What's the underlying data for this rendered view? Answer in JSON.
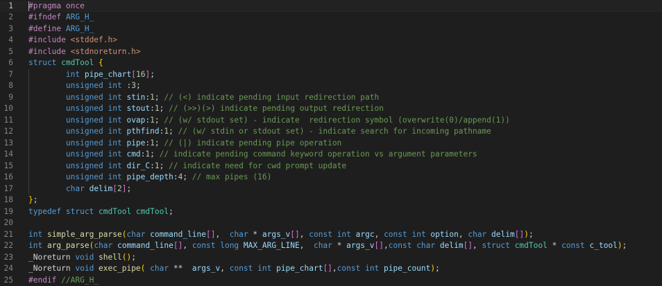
{
  "editor": {
    "current_line": 1,
    "lines": [
      {
        "n": "1",
        "t": [
          [
            "pp",
            "#pragma once"
          ]
        ]
      },
      {
        "n": "2",
        "t": [
          [
            "pp",
            "#ifndef "
          ],
          [
            "mac",
            "ARG_H_"
          ]
        ]
      },
      {
        "n": "3",
        "t": [
          [
            "pp",
            "#define "
          ],
          [
            "mac",
            "ARG_H_"
          ]
        ]
      },
      {
        "n": "4",
        "t": [
          [
            "pp",
            "#include "
          ],
          [
            "inc",
            "<stddef.h>"
          ]
        ]
      },
      {
        "n": "5",
        "t": [
          [
            "pp",
            "#include "
          ],
          [
            "inc",
            "<stdnoreturn.h>"
          ]
        ]
      },
      {
        "n": "6",
        "t": [
          [
            "kw",
            "struct "
          ],
          [
            "ty",
            "cmdTool "
          ],
          [
            "br1",
            "{"
          ]
        ]
      },
      {
        "n": "7",
        "i": 1,
        "t": [
          [
            "df",
            "        "
          ],
          [
            "kw",
            "int "
          ],
          [
            "va",
            "pipe_chart"
          ],
          [
            "br2",
            "["
          ],
          [
            "nu",
            "16"
          ],
          [
            "br2",
            "]"
          ],
          [
            "df",
            ";"
          ]
        ]
      },
      {
        "n": "8",
        "i": 1,
        "t": [
          [
            "df",
            "        "
          ],
          [
            "kw",
            "unsigned int "
          ],
          [
            "df",
            ":"
          ],
          [
            "nu",
            "3"
          ],
          [
            "df",
            ";"
          ]
        ]
      },
      {
        "n": "9",
        "i": 1,
        "t": [
          [
            "df",
            "        "
          ],
          [
            "kw",
            "unsigned int "
          ],
          [
            "va",
            "stin"
          ],
          [
            "df",
            ":"
          ],
          [
            "nu",
            "1"
          ],
          [
            "df",
            "; "
          ],
          [
            "cmt",
            "// (<) indicate pending input redirection path"
          ]
        ]
      },
      {
        "n": "10",
        "i": 1,
        "t": [
          [
            "df",
            "        "
          ],
          [
            "kw",
            "unsigned int "
          ],
          [
            "va",
            "stout"
          ],
          [
            "df",
            ":"
          ],
          [
            "nu",
            "1"
          ],
          [
            "df",
            "; "
          ],
          [
            "cmt",
            "// (>>)(>) indicate pending output redirection"
          ]
        ]
      },
      {
        "n": "11",
        "i": 1,
        "t": [
          [
            "df",
            "        "
          ],
          [
            "kw",
            "unsigned int "
          ],
          [
            "va",
            "ovap"
          ],
          [
            "df",
            ":"
          ],
          [
            "nu",
            "1"
          ],
          [
            "df",
            "; "
          ],
          [
            "cmt",
            "// (w/ stdout set) - indicate  redirection symbol (overwrite(0)/append(1))"
          ]
        ]
      },
      {
        "n": "12",
        "i": 1,
        "t": [
          [
            "df",
            "        "
          ],
          [
            "kw",
            "unsigned int "
          ],
          [
            "va",
            "pthfind"
          ],
          [
            "df",
            ":"
          ],
          [
            "nu",
            "1"
          ],
          [
            "df",
            "; "
          ],
          [
            "cmt",
            "// (w/ stdin or stdout set) - indicate search for incoming pathname"
          ]
        ]
      },
      {
        "n": "13",
        "i": 1,
        "t": [
          [
            "df",
            "        "
          ],
          [
            "kw",
            "unsigned int "
          ],
          [
            "va",
            "pipe"
          ],
          [
            "df",
            ":"
          ],
          [
            "nu",
            "1"
          ],
          [
            "df",
            "; "
          ],
          [
            "cmt",
            "// (|) indicate pending pipe operation"
          ]
        ]
      },
      {
        "n": "14",
        "i": 1,
        "t": [
          [
            "df",
            "        "
          ],
          [
            "kw",
            "unsigned int "
          ],
          [
            "va",
            "cmd"
          ],
          [
            "df",
            ":"
          ],
          [
            "nu",
            "1"
          ],
          [
            "df",
            "; "
          ],
          [
            "cmt",
            "// indicate pending command keyword operation vs argument parameters"
          ]
        ]
      },
      {
        "n": "15",
        "i": 1,
        "t": [
          [
            "df",
            "        "
          ],
          [
            "kw",
            "unsigned int "
          ],
          [
            "va",
            "dir_C"
          ],
          [
            "df",
            ":"
          ],
          [
            "nu",
            "1"
          ],
          [
            "df",
            "; "
          ],
          [
            "cmt",
            "// indicate need for cwd prompt update"
          ]
        ]
      },
      {
        "n": "16",
        "i": 1,
        "t": [
          [
            "df",
            "        "
          ],
          [
            "kw",
            "unsigned int "
          ],
          [
            "va",
            "pipe_depth"
          ],
          [
            "df",
            ":"
          ],
          [
            "nu",
            "4"
          ],
          [
            "df",
            "; "
          ],
          [
            "cmt",
            "// max pipes (16)"
          ]
        ]
      },
      {
        "n": "17",
        "i": 1,
        "t": [
          [
            "df",
            "        "
          ],
          [
            "kw",
            "char "
          ],
          [
            "va",
            "delim"
          ],
          [
            "br2",
            "["
          ],
          [
            "nu",
            "2"
          ],
          [
            "br2",
            "]"
          ],
          [
            "df",
            ";"
          ]
        ]
      },
      {
        "n": "18",
        "t": [
          [
            "br1",
            "}"
          ],
          [
            "df",
            ";"
          ]
        ]
      },
      {
        "n": "19",
        "t": [
          [
            "kw",
            "typedef struct "
          ],
          [
            "ty",
            "cmdTool cmdTool"
          ],
          [
            "df",
            ";"
          ]
        ]
      },
      {
        "n": "20",
        "t": []
      },
      {
        "n": "21",
        "t": [
          [
            "kw",
            "int "
          ],
          [
            "fn",
            "simple_arg_parse"
          ],
          [
            "br1",
            "("
          ],
          [
            "kw",
            "char "
          ],
          [
            "va",
            "command_line"
          ],
          [
            "br2",
            "[]"
          ],
          [
            "df",
            ",  "
          ],
          [
            "kw",
            "char "
          ],
          [
            "df",
            "* "
          ],
          [
            "va",
            "args_v"
          ],
          [
            "br2",
            "[]"
          ],
          [
            "df",
            ", "
          ],
          [
            "kw",
            "const int "
          ],
          [
            "va",
            "argc"
          ],
          [
            "df",
            ", "
          ],
          [
            "kw",
            "const int "
          ],
          [
            "va",
            "option"
          ],
          [
            "df",
            ", "
          ],
          [
            "kw",
            "char "
          ],
          [
            "va",
            "delim"
          ],
          [
            "br2",
            "[]"
          ],
          [
            "br1",
            ")"
          ],
          [
            "df",
            ";"
          ]
        ]
      },
      {
        "n": "22",
        "t": [
          [
            "kw",
            "int "
          ],
          [
            "fn",
            "arg_parse"
          ],
          [
            "br1",
            "("
          ],
          [
            "kw",
            "char "
          ],
          [
            "va",
            "command_line"
          ],
          [
            "br2",
            "[]"
          ],
          [
            "df",
            ", "
          ],
          [
            "kw",
            "const long "
          ],
          [
            "va",
            "MAX_ARG_LINE"
          ],
          [
            "df",
            ",  "
          ],
          [
            "kw",
            "char "
          ],
          [
            "df",
            "* "
          ],
          [
            "va",
            "args_v"
          ],
          [
            "br2",
            "[]"
          ],
          [
            "df",
            ","
          ],
          [
            "kw",
            "const char "
          ],
          [
            "va",
            "delim"
          ],
          [
            "br2",
            "[]"
          ],
          [
            "df",
            ", "
          ],
          [
            "kw",
            "struct "
          ],
          [
            "ty",
            "cmdTool "
          ],
          [
            "df",
            "* "
          ],
          [
            "kw",
            "const "
          ],
          [
            "va",
            "c_tool"
          ],
          [
            "br1",
            ")"
          ],
          [
            "df",
            ";"
          ]
        ]
      },
      {
        "n": "23",
        "t": [
          [
            "df",
            "_Noreturn "
          ],
          [
            "kw",
            "void "
          ],
          [
            "fn",
            "shell"
          ],
          [
            "br1",
            "()"
          ],
          [
            "df",
            ";"
          ]
        ]
      },
      {
        "n": "24",
        "t": [
          [
            "df",
            "_Noreturn "
          ],
          [
            "kw",
            "void "
          ],
          [
            "fn",
            "exec_pipe"
          ],
          [
            "br1",
            "("
          ],
          [
            "df",
            " "
          ],
          [
            "kw",
            "char "
          ],
          [
            "df",
            "**  "
          ],
          [
            "va",
            "args_v"
          ],
          [
            "df",
            ", "
          ],
          [
            "kw",
            "const int "
          ],
          [
            "va",
            "pipe_chart"
          ],
          [
            "br2",
            "[]"
          ],
          [
            "df",
            ","
          ],
          [
            "kw",
            "const int "
          ],
          [
            "va",
            "pipe_count"
          ],
          [
            "br1",
            ")"
          ],
          [
            "df",
            ";"
          ]
        ]
      },
      {
        "n": "25",
        "t": [
          [
            "pp",
            "#endif "
          ],
          [
            "cmt",
            "//ARG_H_"
          ]
        ]
      }
    ]
  }
}
